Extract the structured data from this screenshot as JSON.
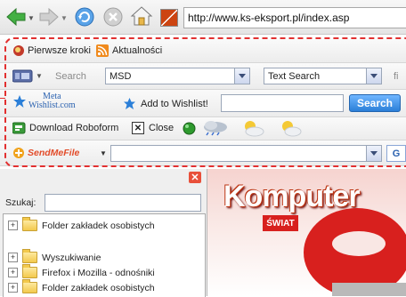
{
  "browser": {
    "url": "http://www.ks-eksport.pl/index.asp"
  },
  "bookmarks_bar": {
    "item1": "Pierwsze kroki",
    "item2": "Aktualności"
  },
  "search_toolbar": {
    "search_label": "Search",
    "query": "MSD",
    "mode": "Text Search",
    "trailing": "fi"
  },
  "wishlist_toolbar": {
    "logo_line1": "Meta",
    "logo_line2": "Wishlist.com",
    "add_label": "Add to Wishlist!",
    "input_value": "",
    "button": "Search"
  },
  "roboform_toolbar": {
    "download": "Download Roboform",
    "close": "Close"
  },
  "sendmefile_toolbar": {
    "logo": "SendMeFile",
    "go": "G"
  },
  "sidebar": {
    "search_label": "Szukaj:",
    "search_value": "",
    "items": [
      {
        "label": "Folder zakładek osobistych"
      },
      {
        "label": "Wyszukiwanie"
      },
      {
        "label": "Firefox i Mozilla - odnośniki"
      },
      {
        "label": "Folder zakładek osobistych"
      }
    ]
  },
  "page": {
    "banner_title": "Komputer",
    "banner_sub": "ŚWIAT"
  },
  "colors": {
    "highlight": "#e23030",
    "nav_arrow": "#3fae3f",
    "banner_red": "#d8201e"
  }
}
